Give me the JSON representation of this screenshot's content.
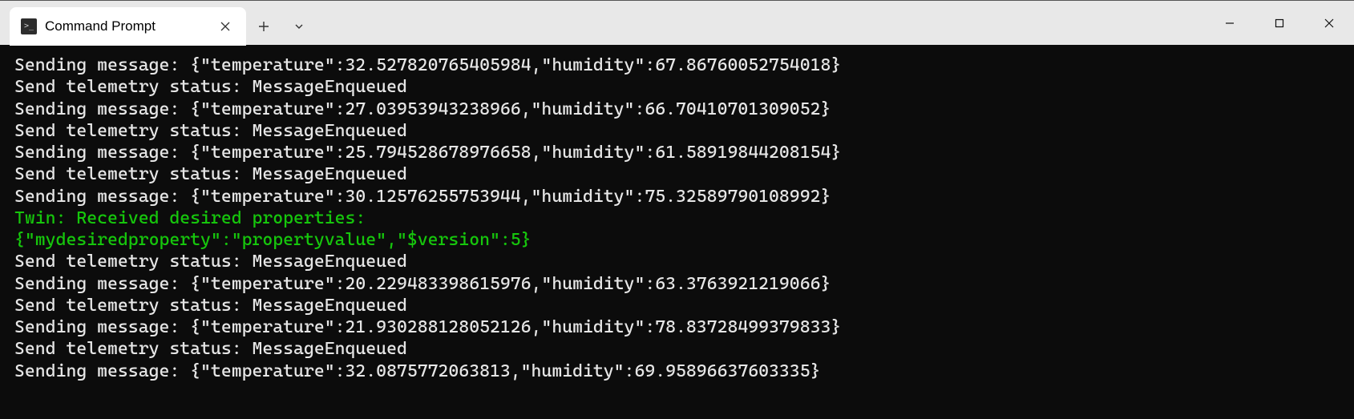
{
  "tab": {
    "title": "Command Prompt",
    "icon_glyph": ">_"
  },
  "terminal": {
    "lines": [
      {
        "text": "Sending message: {\"temperature\":32.527820765405984,\"humidity\":67.86760052754018}",
        "class": ""
      },
      {
        "text": "Send telemetry status: MessageEnqueued",
        "class": ""
      },
      {
        "text": "Sending message: {\"temperature\":27.03953943238966,\"humidity\":66.70410701309052}",
        "class": ""
      },
      {
        "text": "Send telemetry status: MessageEnqueued",
        "class": ""
      },
      {
        "text": "Sending message: {\"temperature\":25.794528678976658,\"humidity\":61.58919844208154}",
        "class": ""
      },
      {
        "text": "Send telemetry status: MessageEnqueued",
        "class": ""
      },
      {
        "text": "Sending message: {\"temperature\":30.12576255753944,\"humidity\":75.32589790108992}",
        "class": ""
      },
      {
        "text": "Twin: Received desired properties:",
        "class": "green"
      },
      {
        "text": "{\"mydesiredproperty\":\"propertyvalue\",\"$version\":5}",
        "class": "green"
      },
      {
        "text": "Send telemetry status: MessageEnqueued",
        "class": ""
      },
      {
        "text": "Sending message: {\"temperature\":20.229483398615976,\"humidity\":63.3763921219066}",
        "class": ""
      },
      {
        "text": "Send telemetry status: MessageEnqueued",
        "class": ""
      },
      {
        "text": "Sending message: {\"temperature\":21.930288128052126,\"humidity\":78.83728499379833}",
        "class": ""
      },
      {
        "text": "Send telemetry status: MessageEnqueued",
        "class": ""
      },
      {
        "text": "Sending message: {\"temperature\":32.0875772063813,\"humidity\":69.95896637603335}",
        "class": ""
      }
    ],
    "telemetry": [
      {
        "temperature": 32.527820765405984,
        "humidity": 67.86760052754018
      },
      {
        "temperature": 27.03953943238966,
        "humidity": 66.70410701309052
      },
      {
        "temperature": 25.794528678976658,
        "humidity": 61.58919844208154
      },
      {
        "temperature": 30.12576255753944,
        "humidity": 75.32589790108992
      },
      {
        "temperature": 20.229483398615976,
        "humidity": 63.3763921219066
      },
      {
        "temperature": 21.930288128052126,
        "humidity": 78.83728499379833
      },
      {
        "temperature": 32.0875772063813,
        "humidity": 69.95896637603335
      }
    ],
    "twin_desired": {
      "mydesiredproperty": "propertyvalue",
      "$version": 5
    }
  },
  "colors": {
    "terminal_bg": "#0c0c0c",
    "terminal_fg": "#e6e6e6",
    "green": "#16c60c",
    "titlebar_bg": "#e8e8e8",
    "tab_bg": "#ffffff"
  }
}
